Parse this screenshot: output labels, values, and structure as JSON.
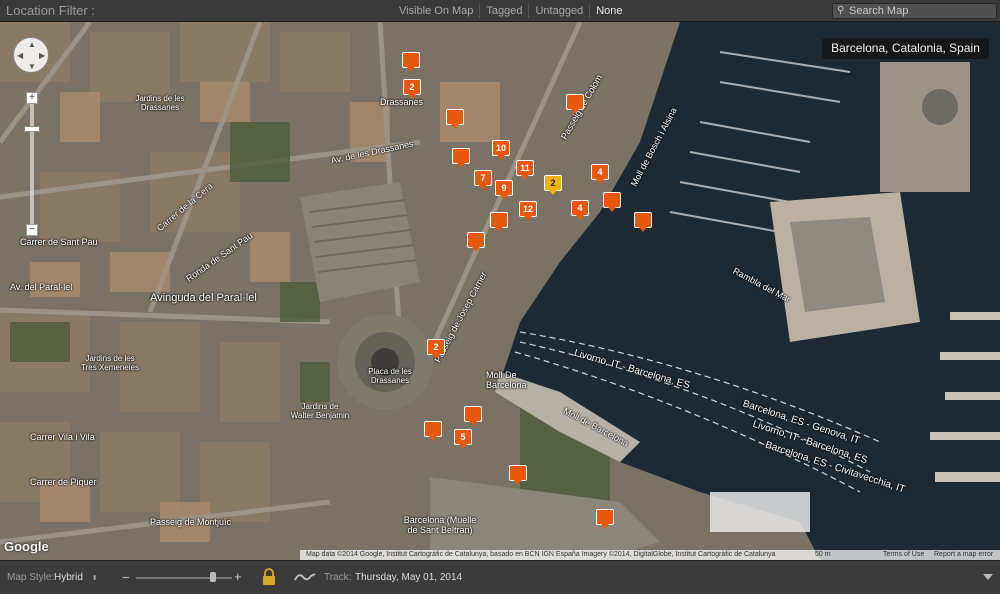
{
  "topbar": {
    "title": "Location Filter :",
    "filters": [
      "Visible On Map",
      "Tagged",
      "Untagged",
      "None"
    ],
    "active_filter": "None",
    "search_placeholder": "Search Map"
  },
  "map": {
    "location": "Barcelona, Catalonia, Spain",
    "labels": [
      "Drassanes",
      "Av. de les Drassanes",
      "Av. del Paral·lel",
      "Ronda de Sant Pau",
      "Avinguda del Paral·lel",
      "Placa de les Drassanes",
      "Moll De Barcelona",
      "Livorno, IT - Barcelona, ES",
      "Barcelona, ES - Genova, IT",
      "Livorno, IT - Barcelona, ES",
      "Barcelona, ES - Civitavecchia, IT",
      "Moll de Barcelona",
      "Barcelona (Muelle de Sant Beltran)",
      "Passeig de Montjuïc",
      "Carrer Vila i Vila",
      "Carrer de Piquer",
      "Passeig de Colom",
      "Rambla del Mar",
      "Jardins de les Drassanes",
      "Jardins de Walter Benjamin",
      "Passeig de Josep Carner",
      "Carrer de la Cera",
      "Carrer de Sant Pau",
      "Jardins de les Tres Xemeneies",
      "Moll de Bosch i Alsina"
    ],
    "pins": [
      "2",
      "",
      "",
      "",
      "10",
      "11",
      "7",
      "9",
      "2",
      "4",
      "",
      "12",
      "4",
      "",
      "",
      "",
      "2",
      "",
      "5",
      "",
      "",
      ""
    ],
    "zoom_plus": "+",
    "zoom_minus": "−",
    "google_logo": "Google",
    "attribution": "Map data ©2014 Google, Institut Cartogràfic de Catalunya, basado en BCN IGN España Imagery ©2014, DigitalGlobe, Institut Cartogràfic de Catalunya",
    "scale": "50 m",
    "terms": "Terms of Use",
    "report": "Report a map error"
  },
  "bottombar": {
    "map_style_label": "Map Style:",
    "map_style_value": "Hybrid",
    "zoom_minus": "−",
    "zoom_plus": "+",
    "zoom_level": 0.8,
    "track_label": "Track:",
    "track_value": "Thursday, May 01, 2014"
  },
  "colors": {
    "pin": "#e8570e",
    "pin_selected": "#f2b20c",
    "water": "#1e2a33"
  }
}
